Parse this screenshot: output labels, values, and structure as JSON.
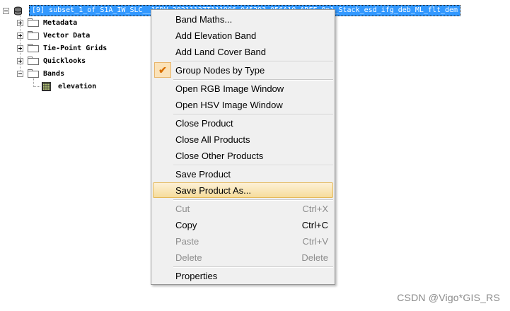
{
  "tree": {
    "product_label": "[9] subset_1_of_S1A_IW_SLC__1SDV_20211127T111906_045293_056A10_ARFF_0p1_Stack_esd_ifg_deb_ML_flt_dem",
    "nodes": [
      {
        "label": "Metadata",
        "icon": "folder-icon",
        "expander": "plus"
      },
      {
        "label": "Vector Data",
        "icon": "folder-icon",
        "expander": "plus"
      },
      {
        "label": "Tie-Point Grids",
        "icon": "folder-icon",
        "expander": "plus"
      },
      {
        "label": "Quicklooks",
        "icon": "folder-icon",
        "expander": "plus"
      },
      {
        "label": "Bands",
        "icon": "folder-icon",
        "expander": "minus"
      }
    ],
    "band": {
      "label": "elevation",
      "icon": "raster-band-icon"
    }
  },
  "menu": {
    "items": [
      {
        "label": "Band Maths...",
        "shortcut": "",
        "disabled": false
      },
      {
        "label": "Add Elevation Band",
        "shortcut": "",
        "disabled": false
      },
      {
        "label": "Add Land Cover Band",
        "shortcut": "",
        "disabled": false
      },
      {
        "label": "Group Nodes by Type",
        "shortcut": "",
        "disabled": false,
        "checked": true
      },
      {
        "label": "Open RGB Image Window",
        "shortcut": "",
        "disabled": false
      },
      {
        "label": "Open HSV Image Window",
        "shortcut": "",
        "disabled": false
      },
      {
        "label": "Close Product",
        "shortcut": "",
        "disabled": false
      },
      {
        "label": "Close All Products",
        "shortcut": "",
        "disabled": false
      },
      {
        "label": "Close Other Products",
        "shortcut": "",
        "disabled": false
      },
      {
        "label": "Save Product",
        "shortcut": "",
        "disabled": false
      },
      {
        "label": "Save Product As...",
        "shortcut": "",
        "disabled": false,
        "hovered": true
      },
      {
        "label": "Cut",
        "shortcut": "Ctrl+X",
        "disabled": true
      },
      {
        "label": "Copy",
        "shortcut": "Ctrl+C",
        "disabled": false
      },
      {
        "label": "Paste",
        "shortcut": "Ctrl+V",
        "disabled": true
      },
      {
        "label": "Delete",
        "shortcut": "Delete",
        "disabled": true
      },
      {
        "label": "Properties",
        "shortcut": "",
        "disabled": false
      }
    ],
    "check_mark": "✔",
    "colors": {
      "hover_border": "#e5b95a",
      "check": "#d96f00",
      "selection": "#3399ff"
    }
  },
  "watermark": "CSDN @Vigo*GIS_RS"
}
